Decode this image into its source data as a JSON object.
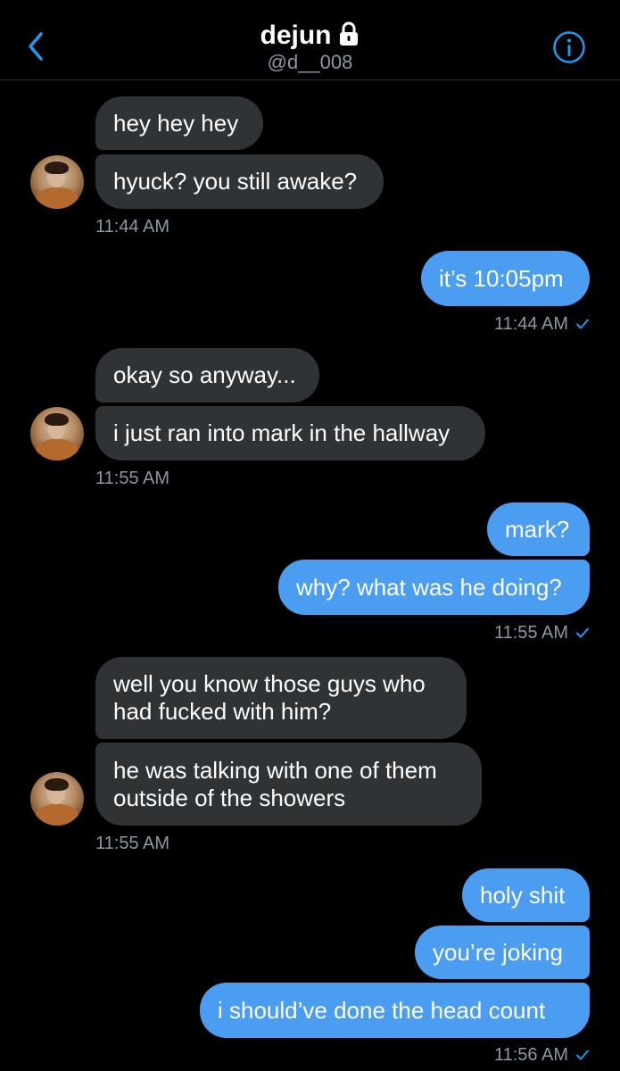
{
  "header": {
    "back_icon": "chevron-left-icon",
    "name": "dejun",
    "lock_icon": "lock-icon",
    "handle": "@d__008",
    "info_icon": "info-icon",
    "accent": "#1d9bf0"
  },
  "colors": {
    "background": "#000000",
    "incoming_bubble": "#2f3336",
    "outgoing_bubble": "#4a9df0",
    "timestamp": "#8b98a5"
  },
  "messages": {
    "m1": "hey hey hey",
    "m2": "hyuck? you still awake?",
    "t1": "11:44 AM",
    "m3": "it’s 10:05pm",
    "t2": "11:44 AM",
    "m4": "okay so anyway...",
    "m5": "i just ran into mark in the hallway",
    "t3": "11:55 AM",
    "m6": "mark?",
    "m7": "why? what was he doing?",
    "t4": "11:55 AM",
    "m8": "well you know those guys who\nhad fucked with him?",
    "m9": "he was talking with one of them\noutside of the showers",
    "t5": "11:55 AM",
    "m10": "holy shit",
    "m11": "you’re joking",
    "m12": "i should’ve done the head count",
    "t6": "11:56 AM"
  }
}
